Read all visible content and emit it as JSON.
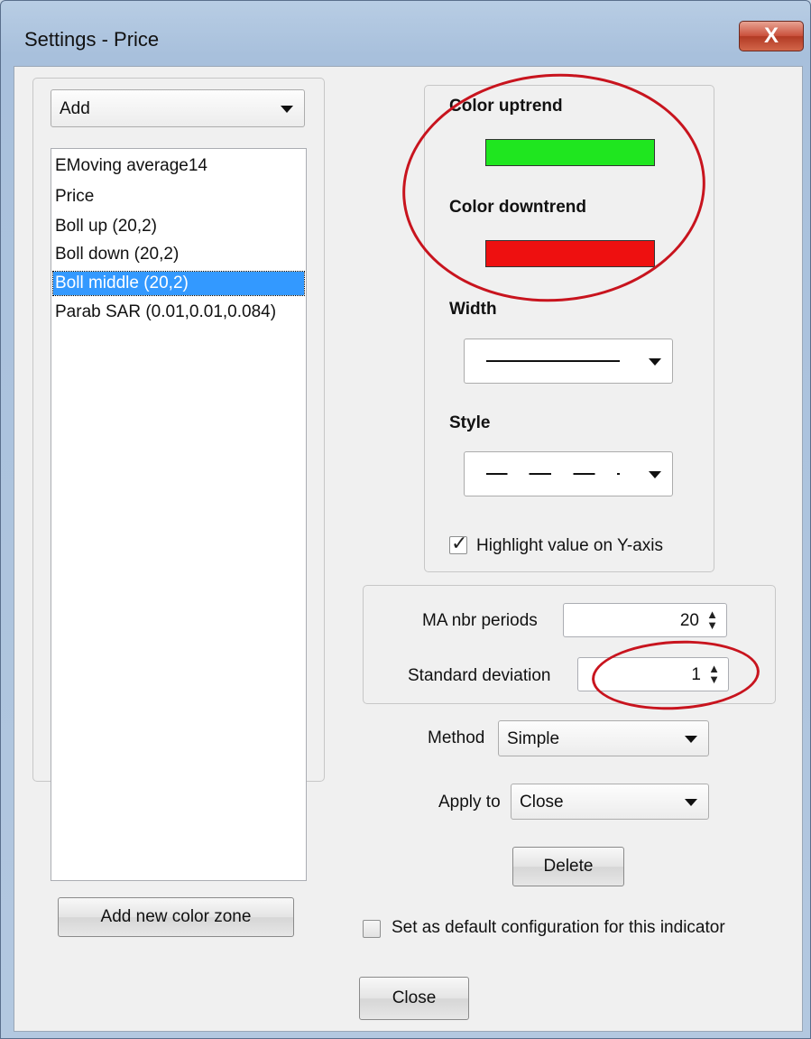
{
  "window": {
    "title": "Settings - Price",
    "close_symbol": "X"
  },
  "left_panel": {
    "add_combo": {
      "value": "Add"
    },
    "indicators": [
      "EMoving average14",
      "Price",
      "Boll up (20,2)",
      "Boll down (20,2)",
      "Boll middle (20,2)",
      "Parab SAR (0.01,0.01,0.084)"
    ],
    "selected_index": 4,
    "add_color_zone_label": "Add new color zone"
  },
  "line_settings": {
    "color_uptrend_label": "Color uptrend",
    "color_uptrend": "#1fe61f",
    "color_downtrend_label": "Color downtrend",
    "color_downtrend": "#ee1010",
    "width_label": "Width",
    "style_label": "Style",
    "highlight_label": "Highlight value on Y-axis",
    "highlight_checked": true
  },
  "params": {
    "ma_periods_label": "MA nbr periods",
    "ma_periods_value": "20",
    "std_dev_label": "Standard deviation",
    "std_dev_value": "1"
  },
  "method": {
    "label": "Method",
    "value": "Simple"
  },
  "apply_to": {
    "label": "Apply to",
    "value": "Close"
  },
  "delete_label": "Delete",
  "default_config": {
    "label": "Set as default configuration for this indicator",
    "checked": false
  },
  "close_label": "Close",
  "annotation_color": "#c8141e"
}
